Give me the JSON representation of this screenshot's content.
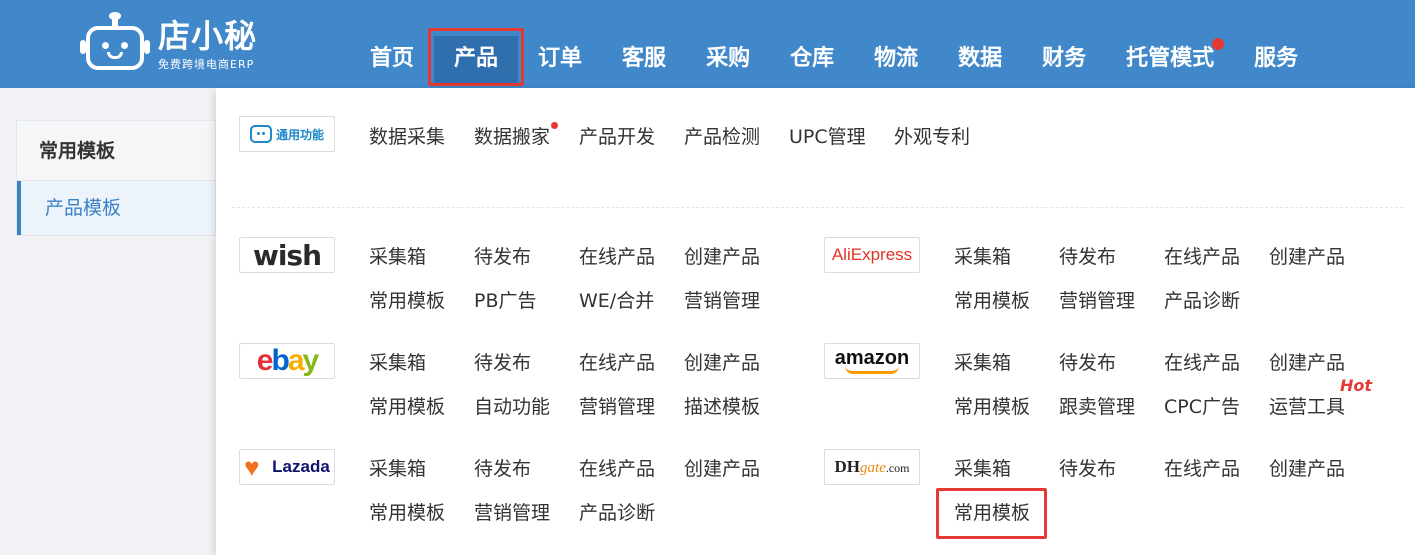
{
  "brand": {
    "name": "店小秘",
    "subtitle": "免费跨境电商ERP"
  },
  "nav": [
    {
      "label": "首页",
      "active": false
    },
    {
      "label": "产品",
      "active": true
    },
    {
      "label": "订单",
      "active": false
    },
    {
      "label": "客服",
      "active": false
    },
    {
      "label": "采购",
      "active": false
    },
    {
      "label": "仓库",
      "active": false
    },
    {
      "label": "物流",
      "active": false
    },
    {
      "label": "数据",
      "active": false
    },
    {
      "label": "财务",
      "active": false
    },
    {
      "label": "托管模式",
      "active": false,
      "badge_dot": true
    },
    {
      "label": "服务",
      "active": false
    }
  ],
  "left_panel": {
    "title": "常用模板",
    "items": [
      {
        "label": "产品模板",
        "active": true
      }
    ]
  },
  "dropdown": {
    "common": {
      "tag": "通用功能",
      "links": [
        "数据采集",
        "数据搬家",
        "产品开发",
        "产品检测",
        "UPC管理",
        "外观专利"
      ]
    },
    "wish": {
      "tag": "wish",
      "links": [
        "采集箱",
        "待发布",
        "在线产品",
        "创建产品",
        "常用模板",
        "PB广告",
        "WE/合并",
        "营销管理"
      ]
    },
    "aliexpress": {
      "tag": "AliExpress",
      "links": [
        "采集箱",
        "待发布",
        "在线产品",
        "创建产品",
        "常用模板",
        "营销管理",
        "产品诊断"
      ]
    },
    "ebay": {
      "tag": "ebay",
      "links": [
        "采集箱",
        "待发布",
        "在线产品",
        "创建产品",
        "常用模板",
        "自动功能",
        "营销管理",
        "描述模板"
      ]
    },
    "amazon": {
      "tag": "amazon",
      "links": [
        "采集箱",
        "待发布",
        "在线产品",
        "创建产品",
        "常用模板",
        "跟卖管理",
        "CPC广告",
        "运营工具"
      ],
      "hot_label": "Hot"
    },
    "lazada": {
      "tag": "Lazada",
      "links": [
        "采集箱",
        "待发布",
        "在线产品",
        "创建产品",
        "常用模板",
        "营销管理",
        "产品诊断"
      ]
    },
    "dhgate": {
      "tag_dh": "DH",
      "tag_gate": "gate",
      "tag_com": ".com",
      "links": [
        "采集箱",
        "待发布",
        "在线产品",
        "创建产品",
        "常用模板"
      ]
    }
  },
  "colors": {
    "header_bg": "#4088c9",
    "active_nav_bg": "#2f6fae",
    "highlight": "#e53935",
    "link_blue": "#3b82c4"
  }
}
